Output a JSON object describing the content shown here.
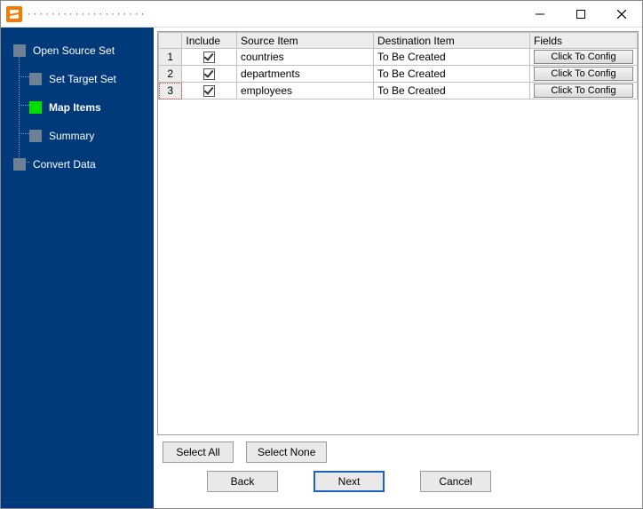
{
  "window": {
    "title": "· · · · · · · · · · · · · · · · · · · ·"
  },
  "sidebar": {
    "steps": [
      {
        "label": "Open Source Set"
      },
      {
        "label": "Set Target Set"
      },
      {
        "label": "Map Items"
      },
      {
        "label": "Summary"
      },
      {
        "label": "Convert Data"
      }
    ],
    "active_index": 2
  },
  "grid": {
    "headers": {
      "include": "Include",
      "source": "Source Item",
      "destination": "Destination Item",
      "fields": "Fields"
    },
    "config_label": "Click To Config",
    "rows": [
      {
        "num": "1",
        "include": true,
        "source": "countries",
        "destination": "To Be Created"
      },
      {
        "num": "2",
        "include": true,
        "source": "departments",
        "destination": "To Be Created"
      },
      {
        "num": "3",
        "include": true,
        "source": "employees",
        "destination": "To Be Created"
      }
    ],
    "selected_row": 3
  },
  "buttons": {
    "select_all": "Select All",
    "select_none": "Select None",
    "back": "Back",
    "next": "Next",
    "cancel": "Cancel"
  }
}
